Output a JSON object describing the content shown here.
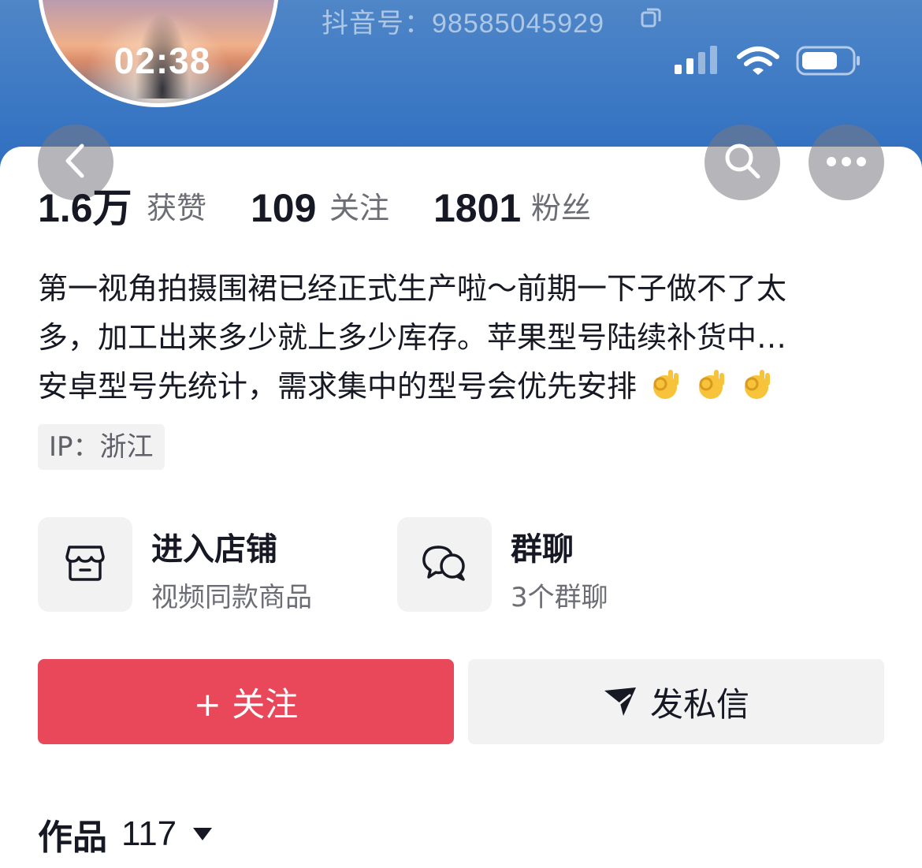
{
  "header": {
    "avatar_time": "02:38",
    "douyin_id": "抖音号：98585045929"
  },
  "stats": {
    "likes_num": "1.6万",
    "likes_label": "获赞",
    "following_num": "109",
    "following_label": "关注",
    "fans_num": "1801",
    "fans_label": "粉丝"
  },
  "bio": {
    "line1": "第一视角拍摄围裙已经正式生产啦～前期一下子做不了太",
    "line2": "多，加工出来多少就上多少库存。苹果型号陆续补货中…",
    "line3": "安卓型号先统计，需求集中的型号会优先安排"
  },
  "ip": "IP：浙江",
  "entries": {
    "shop_title": "进入店铺",
    "shop_sub": "视频同款商品",
    "group_title": "群聊",
    "group_sub": "3个群聊"
  },
  "actions": {
    "follow_label": "+ 关注",
    "message_label": "发私信"
  },
  "works": {
    "label": "作品",
    "count": "117"
  },
  "colors": {
    "follow_red": "#e8485a",
    "header_blue": "#3d79c4"
  },
  "icons": [
    "back-icon",
    "search-icon",
    "more-icon",
    "copy-icon",
    "store-icon",
    "group-chat-icon",
    "send-icon",
    "dropdown-arrow-icon"
  ]
}
